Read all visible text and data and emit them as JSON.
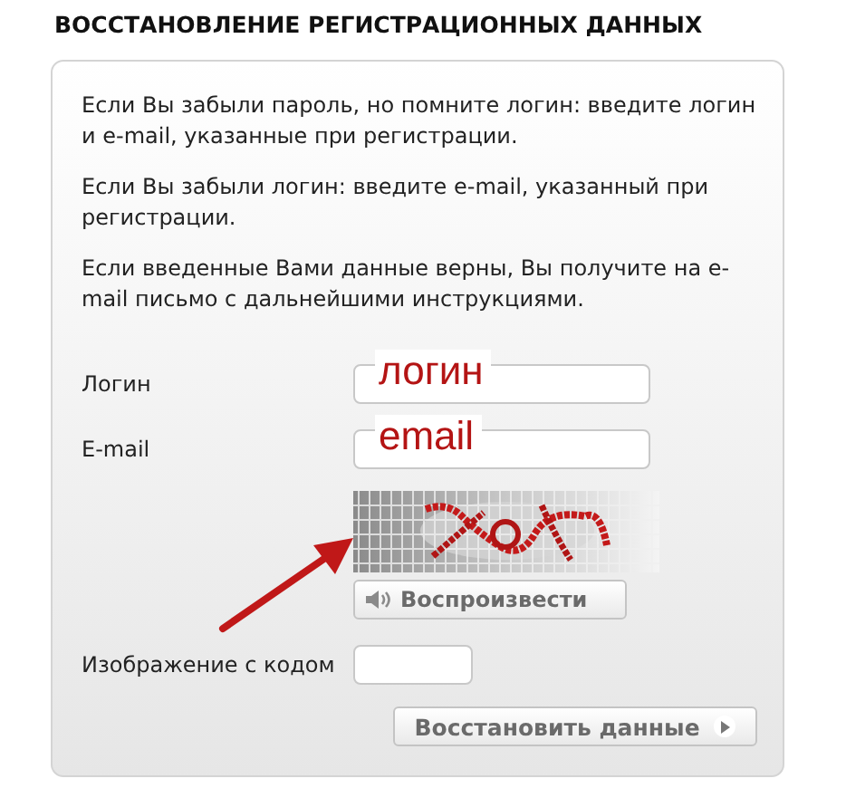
{
  "heading": "ВОССТАНОВЛЕНИЕ РЕГИСТРАЦИОННЫХ ДАННЫХ",
  "paragraphs": [
    "Если Вы забыли пароль, но помните логин: введите логин и e-mail, указанные при регистрации.",
    "Если Вы забыли логин: введите e-mail, указанный при регистрации.",
    "Если введенные Вами данные верны, Вы получите на e-mail письмо с дальнейшими инструкциями."
  ],
  "fields": [
    {
      "kind": "text",
      "label": "Логин",
      "annotation": "логин"
    },
    {
      "kind": "text",
      "label": "E-mail",
      "annotation": "email"
    },
    {
      "kind": "captcha",
      "arrow": true,
      "play_button": "Воспроизвести"
    },
    {
      "kind": "code",
      "label": "Изображение с кодом"
    }
  ],
  "submit": "Восстановить данные"
}
